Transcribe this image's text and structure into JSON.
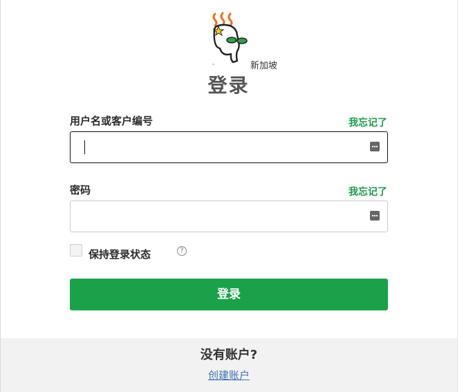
{
  "header": {
    "region": "新加坡",
    "title": "登录"
  },
  "username": {
    "label": "用户名或客户编号",
    "forgot": "我忘记了",
    "value": ""
  },
  "password": {
    "label": "密码",
    "forgot": "我忘记了",
    "value": ""
  },
  "remember": {
    "label": "保持登录状态",
    "help": "?"
  },
  "submit": {
    "label": "登录"
  },
  "footer": {
    "question": "没有账户?",
    "create_link": "创建账户"
  },
  "colors": {
    "brand_green": "#1ba149",
    "link_green": "#1a9a4a",
    "link_blue": "#3f6fb3",
    "logo_orange": "#f26d21"
  },
  "icons": [
    "godaddy-logo-icon",
    "password-manager-key-icon",
    "help-circle-icon"
  ]
}
